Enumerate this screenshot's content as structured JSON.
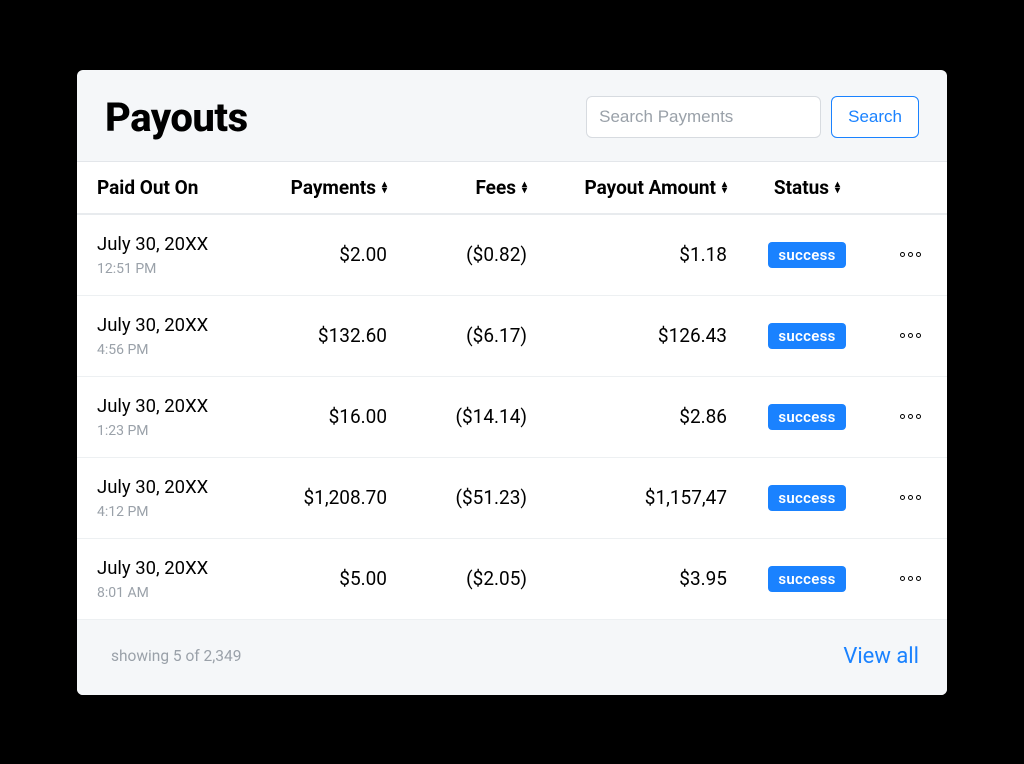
{
  "header": {
    "title": "Payouts",
    "search_placeholder": "Search Payments",
    "search_button": "Search"
  },
  "columns": {
    "paid_out_on": "Paid Out On",
    "payments": "Payments",
    "fees": "Fees",
    "payout_amount": "Payout Amount",
    "status": "Status"
  },
  "rows": [
    {
      "date": "July 30, 20XX",
      "time": "12:51 PM",
      "payments": "$2.00",
      "fees": "($0.82)",
      "amount": "$1.18",
      "status": "success"
    },
    {
      "date": "July 30, 20XX",
      "time": "4:56 PM",
      "payments": "$132.60",
      "fees": "($6.17)",
      "amount": "$126.43",
      "status": "success"
    },
    {
      "date": "July 30, 20XX",
      "time": "1:23 PM",
      "payments": "$16.00",
      "fees": "($14.14)",
      "amount": "$2.86",
      "status": "success"
    },
    {
      "date": "July 30, 20XX",
      "time": "4:12 PM",
      "payments": "$1,208.70",
      "fees": "($51.23)",
      "amount": "$1,157,47",
      "status": "success"
    },
    {
      "date": "July 30, 20XX",
      "time": "8:01 AM",
      "payments": "$5.00",
      "fees": "($2.05)",
      "amount": "$3.95",
      "status": "success"
    }
  ],
  "footer": {
    "showing": "showing 5 of 2,349",
    "view_all": "View all"
  },
  "colors": {
    "accent": "#1a82ff"
  }
}
